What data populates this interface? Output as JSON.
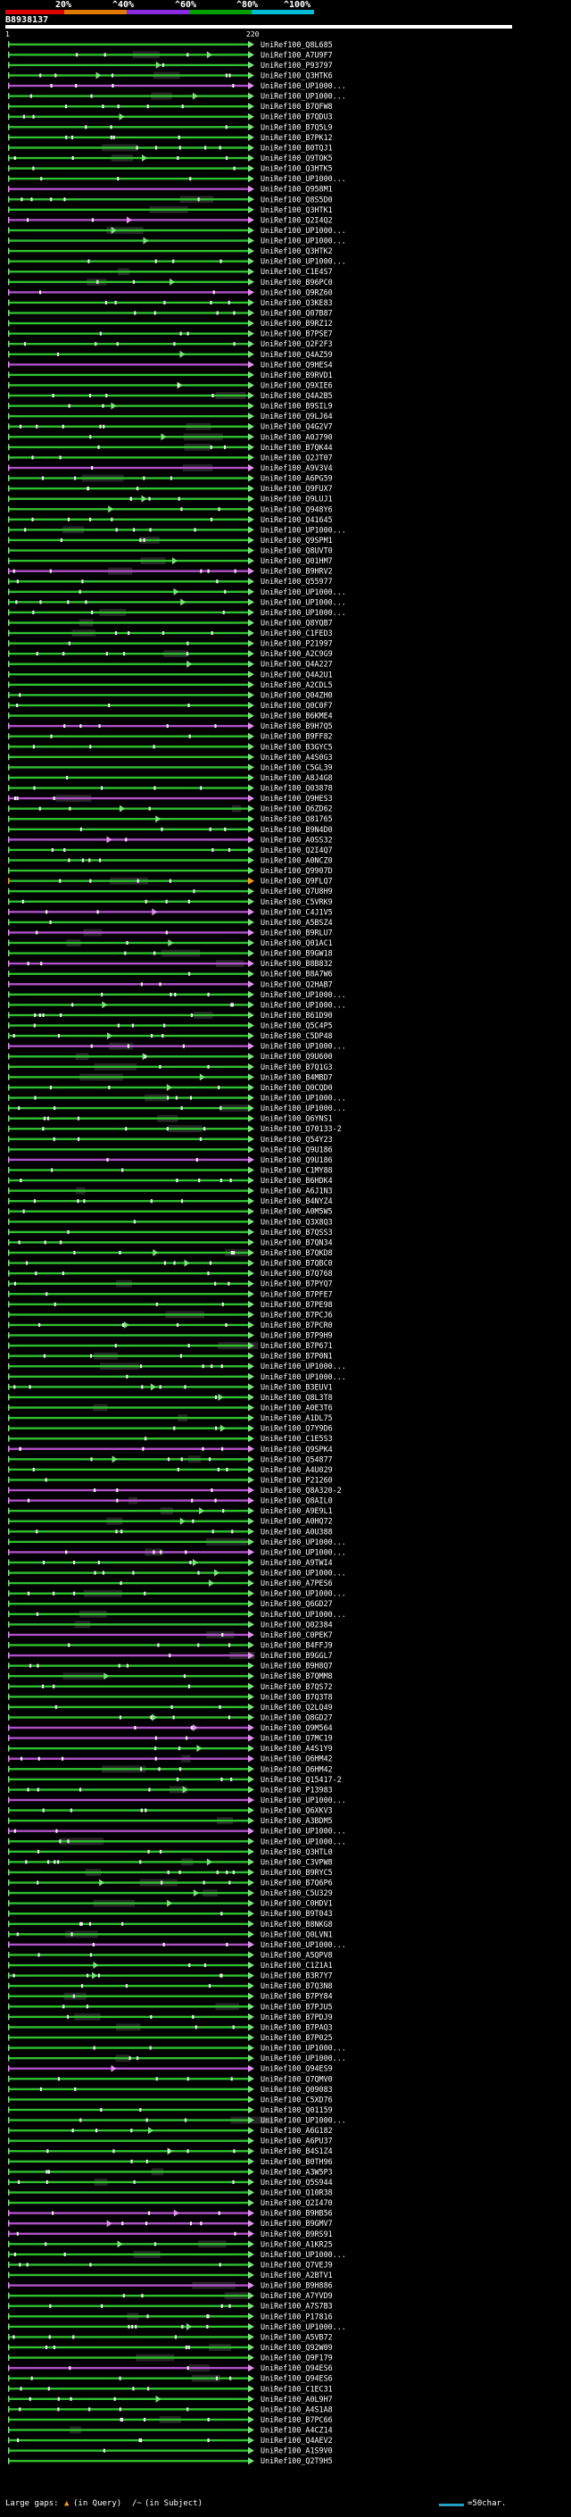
{
  "header": {
    "scale_labels": [
      "20%",
      "^40%",
      "^60%",
      "^80%",
      "^100%"
    ],
    "scale_colors": [
      "#e00000",
      "#e07a00",
      "#8a2be2",
      "#00a000",
      "#00bcd4"
    ],
    "query_id": "B8938137",
    "query_start": "1",
    "query_end": "220"
  },
  "colors": {
    "hit_green": "#2fc02f",
    "hit_magenta": "#b050c8",
    "arrow_green": "#7be37b",
    "arrow_magenta": "#e090ee",
    "arrow_orange": "#ff9a1a",
    "dot": "#ffffff",
    "gap_block": "#242424"
  },
  "hits": [
    {
      "label": "UniRef100_Q8L685",
      "color": "green"
    },
    {
      "label": "UniRef100_A7U9F7",
      "color": "green"
    },
    {
      "label": "UniRef100_P93797",
      "color": "green"
    },
    {
      "label": "UniRef100_Q3HTK6",
      "color": "green"
    },
    {
      "label": "UniRef100_UP1000...",
      "color": "magenta"
    },
    {
      "label": "UniRef100_UP1000...",
      "color": "green"
    },
    {
      "label": "UniRef100_B7QFW8",
      "color": "green"
    },
    {
      "label": "UniRef100_B7QDU3",
      "color": "green"
    },
    {
      "label": "UniRef100_B7Q5L9",
      "color": "green"
    },
    {
      "label": "UniRef100_B7PK12",
      "color": "green"
    },
    {
      "label": "UniRef100_B0TQJ1",
      "color": "green"
    },
    {
      "label": "UniRef100_Q9TOK5",
      "color": "green"
    },
    {
      "label": "UniRef100_Q3HTK5",
      "color": "green"
    },
    {
      "label": "UniRef100_UP1000...",
      "color": "green"
    },
    {
      "label": "UniRef100_Q958M1",
      "color": "magenta"
    },
    {
      "label": "UniRef100_Q8S5D0",
      "color": "green"
    },
    {
      "label": "UniRef100_Q3HTK1",
      "color": "green"
    },
    {
      "label": "UniRef100_Q2I4Q2",
      "color": "magenta"
    },
    {
      "label": "UniRef100_UP1000...",
      "color": "green"
    },
    {
      "label": "UniRef100_UP1000...",
      "color": "green"
    },
    {
      "label": "UniRef100_Q3HTK2",
      "color": "green"
    },
    {
      "label": "UniRef100_UP1000...",
      "color": "green"
    },
    {
      "label": "UniRef100_C1E4S7",
      "color": "green"
    },
    {
      "label": "UniRef100_B96PC0",
      "color": "green"
    },
    {
      "label": "UniRef100_Q9RZ60",
      "color": "magenta"
    },
    {
      "label": "UniRef100_Q3KE83",
      "color": "green"
    },
    {
      "label": "UniRef100_Q07B87",
      "color": "green"
    },
    {
      "label": "UniRef100_B9RZ12",
      "color": "green"
    },
    {
      "label": "UniRef100_B7PSE7",
      "color": "green"
    },
    {
      "label": "UniRef100_Q2F2F3",
      "color": "green"
    },
    {
      "label": "UniRef100_Q4AZ59",
      "color": "green"
    },
    {
      "label": "UniRef100_Q9HES4",
      "color": "magenta"
    },
    {
      "label": "UniRef100_B9RVD1",
      "color": "green"
    },
    {
      "label": "UniRef100_Q9XIE6",
      "color": "green"
    },
    {
      "label": "UniRef100_Q4A2B5",
      "color": "green"
    },
    {
      "label": "UniRef100_B9SIL9",
      "color": "green"
    },
    {
      "label": "UniRef100_Q9LJ64",
      "color": "green"
    },
    {
      "label": "UniRef100_Q4G2V7",
      "color": "green"
    },
    {
      "label": "UniRef100_A0J790",
      "color": "green"
    },
    {
      "label": "UniRef100_B7QK44",
      "color": "green"
    },
    {
      "label": "UniRef100_Q2JT07",
      "color": "green"
    },
    {
      "label": "UniRef100_A9V3V4",
      "color": "magenta"
    },
    {
      "label": "UniRef100_A6PG59",
      "color": "green"
    },
    {
      "label": "UniRef100_Q9FUX7",
      "color": "green"
    },
    {
      "label": "UniRef100_Q9LUJ1",
      "color": "green"
    },
    {
      "label": "UniRef100_Q948Y6",
      "color": "green"
    },
    {
      "label": "UniRef100_Q41645",
      "color": "green"
    },
    {
      "label": "UniRef100_UP1000...",
      "color": "green"
    },
    {
      "label": "UniRef100_Q9SPM1",
      "color": "green"
    },
    {
      "label": "UniRef100_Q8UVT0",
      "color": "green"
    },
    {
      "label": "UniRef100_Q01HM7",
      "color": "green"
    },
    {
      "label": "UniRef100_B9HRV2",
      "color": "magenta"
    },
    {
      "label": "UniRef100_Q55977",
      "color": "green"
    },
    {
      "label": "UniRef100_UP1000...",
      "color": "green"
    },
    {
      "label": "UniRef100_UP1000...",
      "color": "green"
    },
    {
      "label": "UniRef100_UP1000...",
      "color": "green"
    },
    {
      "label": "UniRef100_Q8YQB7",
      "color": "green"
    },
    {
      "label": "UniRef100_C1FED3",
      "color": "green"
    },
    {
      "label": "UniRef100_P21997",
      "color": "green"
    },
    {
      "label": "UniRef100_A2C9G9",
      "color": "green"
    },
    {
      "label": "UniRef100_Q4A227",
      "color": "green"
    },
    {
      "label": "UniRef100_Q4A2U1",
      "color": "green"
    },
    {
      "label": "UniRef100_A2CDL5",
      "color": "green"
    },
    {
      "label": "UniRef100_Q04ZH0",
      "color": "green"
    },
    {
      "label": "UniRef100_Q0C0F7",
      "color": "green"
    },
    {
      "label": "UniRef100_B6KME4",
      "color": "green"
    },
    {
      "label": "UniRef100_B9H7Q5",
      "color": "magenta"
    },
    {
      "label": "UniRef100_B9FF82",
      "color": "green"
    },
    {
      "label": "UniRef100_B3GYC5",
      "color": "green"
    },
    {
      "label": "UniRef100_A4S0G3",
      "color": "green"
    },
    {
      "label": "UniRef100_C5GL39",
      "color": "green"
    },
    {
      "label": "UniRef100_A8J4G8",
      "color": "green"
    },
    {
      "label": "UniRef100_Q03878",
      "color": "green"
    },
    {
      "label": "UniRef100_Q9HES3",
      "color": "magenta"
    },
    {
      "label": "UniRef100_Q6ZD62",
      "color": "green"
    },
    {
      "label": "UniRef100_Q81765",
      "color": "green"
    },
    {
      "label": "UniRef100_B9N4D0",
      "color": "green"
    },
    {
      "label": "UniRef100_A0SS32",
      "color": "magenta"
    },
    {
      "label": "UniRef100_Q2I4Q7",
      "color": "green"
    },
    {
      "label": "UniRef100_A0NCZ0",
      "color": "green"
    },
    {
      "label": "UniRef100_Q9907D",
      "color": "green"
    },
    {
      "label": "UniRef100_Q9FLQ7",
      "color": "orange"
    },
    {
      "label": "UniRef100_Q7U8H9",
      "color": "green"
    },
    {
      "label": "UniRef100_C5VRK9",
      "color": "green"
    },
    {
      "label": "UniRef100_C4J1V5",
      "color": "magenta"
    },
    {
      "label": "UniRef100_A5BSZ4",
      "color": "green"
    },
    {
      "label": "UniRef100_B9RLU7",
      "color": "magenta"
    },
    {
      "label": "UniRef100_Q01AC1",
      "color": "green"
    },
    {
      "label": "UniRef100_B9GW18",
      "color": "green"
    },
    {
      "label": "UniRef100_B8B832",
      "color": "magenta"
    },
    {
      "label": "UniRef100_B8A7W6",
      "color": "green"
    },
    {
      "label": "UniRef100_Q2HAB7",
      "color": "magenta"
    },
    {
      "label": "UniRef100_UP1000...",
      "color": "green"
    },
    {
      "label": "UniRef100_UP1000...",
      "color": "green"
    },
    {
      "label": "UniRef100_B61D90",
      "color": "green"
    },
    {
      "label": "UniRef100_Q5C4P5",
      "color": "green"
    },
    {
      "label": "UniRef100_C5DP48",
      "color": "green"
    },
    {
      "label": "UniRef100_UP1000...",
      "color": "magenta"
    },
    {
      "label": "UniRef100_Q9U600",
      "color": "green"
    },
    {
      "label": "UniRef100_B7Q1G3",
      "color": "green"
    },
    {
      "label": "UniRef100_B4MBD7",
      "color": "green"
    },
    {
      "label": "UniRef100_Q0CQD0",
      "color": "green"
    },
    {
      "label": "UniRef100_UP1000...",
      "color": "green"
    },
    {
      "label": "UniRef100_UP1000...",
      "color": "green"
    },
    {
      "label": "UniRef100_Q6YNS1",
      "color": "green"
    },
    {
      "label": "UniRef100_Q70133-2",
      "color": "green"
    },
    {
      "label": "UniRef100_Q54Y23",
      "color": "green"
    },
    {
      "label": "UniRef100_Q9U186",
      "color": "green"
    },
    {
      "label": "UniRef100_Q9U186",
      "color": "magenta"
    },
    {
      "label": "UniRef100_C1MY88",
      "color": "green"
    },
    {
      "label": "UniRef100_B6HDK4",
      "color": "green"
    },
    {
      "label": "UniRef100_A6J1N3",
      "color": "green"
    },
    {
      "label": "UniRef100_B4NYZ4",
      "color": "green"
    },
    {
      "label": "UniRef100_A0M5W5",
      "color": "green"
    },
    {
      "label": "UniRef100_Q3X8Q3",
      "color": "green"
    },
    {
      "label": "UniRef100_B7QSS3",
      "color": "green"
    },
    {
      "label": "UniRef100_B7QN34",
      "color": "green"
    },
    {
      "label": "UniRef100_B7QKD8",
      "color": "green"
    },
    {
      "label": "UniRef100_B7QBC0",
      "color": "green"
    },
    {
      "label": "UniRef100_B7Q768",
      "color": "green"
    },
    {
      "label": "UniRef100_B7PYQ7",
      "color": "green"
    },
    {
      "label": "UniRef100_B7PFE7",
      "color": "green"
    },
    {
      "label": "UniRef100_B7PE98",
      "color": "green"
    },
    {
      "label": "UniRef100_B7PCJ6",
      "color": "green"
    },
    {
      "label": "UniRef100_B7PCR0",
      "color": "green"
    },
    {
      "label": "UniRef100_B7P9H9",
      "color": "green"
    },
    {
      "label": "UniRef100_B7P671",
      "color": "green"
    },
    {
      "label": "UniRef100_B7P0N1",
      "color": "green"
    },
    {
      "label": "UniRef100_UP1000...",
      "color": "green"
    },
    {
      "label": "UniRef100_UP1000...",
      "color": "green"
    },
    {
      "label": "UniRef100_B3EUV1",
      "color": "green"
    },
    {
      "label": "UniRef100_Q8L3T8",
      "color": "green"
    },
    {
      "label": "UniRef100_A0E3T6",
      "color": "green"
    },
    {
      "label": "UniRef100_A1DL75",
      "color": "green"
    },
    {
      "label": "UniRef100_Q7Y9D6",
      "color": "green"
    },
    {
      "label": "UniRef100_C1E5S3",
      "color": "green"
    },
    {
      "label": "UniRef100_Q9SPK4",
      "color": "magenta"
    },
    {
      "label": "UniRef100_Q54877",
      "color": "green"
    },
    {
      "label": "UniRef100_A4U029",
      "color": "green"
    },
    {
      "label": "UniRef100_P21260",
      "color": "green"
    },
    {
      "label": "UniRef100_Q8A320-2",
      "color": "magenta"
    },
    {
      "label": "UniRef100_Q8AIL0",
      "color": "magenta"
    },
    {
      "label": "UniRef100_A9E9L1",
      "color": "green"
    },
    {
      "label": "UniRef100_A0HQ72",
      "color": "green"
    },
    {
      "label": "UniRef100_A0U388",
      "color": "green"
    },
    {
      "label": "UniRef100_UP1000...",
      "color": "green"
    },
    {
      "label": "UniRef100_UP1000...",
      "color": "magenta"
    },
    {
      "label": "UniRef100_A9TWI4",
      "color": "green"
    },
    {
      "label": "UniRef100_UP1000...",
      "color": "green"
    },
    {
      "label": "UniRef100_A7PES6",
      "color": "green"
    },
    {
      "label": "UniRef100_UP1000...",
      "color": "green"
    },
    {
      "label": "UniRef100_Q6GD27",
      "color": "green"
    },
    {
      "label": "UniRef100_UP1000...",
      "color": "green"
    },
    {
      "label": "UniRef100_Q02384",
      "color": "green"
    },
    {
      "label": "UniRef100_C0PEK7",
      "color": "magenta"
    },
    {
      "label": "UniRef100_B4FFJ9",
      "color": "green"
    },
    {
      "label": "UniRef100_B9GGL7",
      "color": "magenta"
    },
    {
      "label": "UniRef100_B9H8Q7",
      "color": "green"
    },
    {
      "label": "UniRef100_B7QMM8",
      "color": "green"
    },
    {
      "label": "UniRef100_B7QS72",
      "color": "green"
    },
    {
      "label": "UniRef100_B7Q3T8",
      "color": "green"
    },
    {
      "label": "UniRef100_Q2LQ49",
      "color": "green"
    },
    {
      "label": "UniRef100_Q8GD27",
      "color": "green"
    },
    {
      "label": "UniRef100_Q9M564",
      "color": "magenta"
    },
    {
      "label": "UniRef100_Q7MC19",
      "color": "magenta"
    },
    {
      "label": "UniRef100_A4S1Y9",
      "color": "green"
    },
    {
      "label": "UniRef100_Q6HM42",
      "color": "magenta"
    },
    {
      "label": "UniRef100_Q6HM42",
      "color": "green"
    },
    {
      "label": "UniRef100_Q15417-2",
      "color": "green"
    },
    {
      "label": "UniRef100_P13983",
      "color": "green"
    },
    {
      "label": "UniRef100_UP1000...",
      "color": "magenta"
    },
    {
      "label": "UniRef100_Q6XKV3",
      "color": "green"
    },
    {
      "label": "UniRef100_A3BDM5",
      "color": "green"
    },
    {
      "label": "UniRef100_UP1000...",
      "color": "magenta"
    },
    {
      "label": "UniRef100_UP1000...",
      "color": "green"
    },
    {
      "label": "UniRef100_Q3HTL0",
      "color": "green"
    },
    {
      "label": "UniRef100_C3VPW8",
      "color": "green"
    },
    {
      "label": "UniRef100_B9RYC5",
      "color": "green"
    },
    {
      "label": "UniRef100_B7Q6P6",
      "color": "green"
    },
    {
      "label": "UniRef100_C5U329",
      "color": "green"
    },
    {
      "label": "UniRef100_C0HDV1",
      "color": "green"
    },
    {
      "label": "UniRef100_B9T043",
      "color": "green"
    },
    {
      "label": "UniRef100_B8NKG8",
      "color": "green"
    },
    {
      "label": "UniRef100_Q0LVN1",
      "color": "green"
    },
    {
      "label": "UniRef100_UP1000...",
      "color": "magenta"
    },
    {
      "label": "UniRef100_A5QPV8",
      "color": "green"
    },
    {
      "label": "UniRef100_C1Z1A1",
      "color": "green"
    },
    {
      "label": "UniRef100_B3R7Y7",
      "color": "green"
    },
    {
      "label": "UniRef100_B7Q3N8",
      "color": "green"
    },
    {
      "label": "UniRef100_B7PY84",
      "color": "green"
    },
    {
      "label": "UniRef100_B7PJU5",
      "color": "green"
    },
    {
      "label": "UniRef100_B7PDJ9",
      "color": "green"
    },
    {
      "label": "UniRef100_B7PAQ3",
      "color": "green"
    },
    {
      "label": "UniRef100_B7P025",
      "color": "green"
    },
    {
      "label": "UniRef100_UP1000...",
      "color": "green"
    },
    {
      "label": "UniRef100_UP1000...",
      "color": "green"
    },
    {
      "label": "UniRef100_Q94ES9",
      "color": "magenta"
    },
    {
      "label": "UniRef100_Q7QMV0",
      "color": "green"
    },
    {
      "label": "UniRef100_Q09083",
      "color": "green"
    },
    {
      "label": "UniRef100_C5XD76",
      "color": "green"
    },
    {
      "label": "UniRef100_Q01159",
      "color": "green"
    },
    {
      "label": "UniRef100_UP1000...",
      "color": "green"
    },
    {
      "label": "UniRef100_A6G182",
      "color": "green"
    },
    {
      "label": "UniRef100_A6PU37",
      "color": "green"
    },
    {
      "label": "UniRef100_B4S1Z4",
      "color": "green"
    },
    {
      "label": "UniRef100_B0TH96",
      "color": "green"
    },
    {
      "label": "UniRef100_A3W5P3",
      "color": "green"
    },
    {
      "label": "UniRef100_Q5S944",
      "color": "green"
    },
    {
      "label": "UniRef100_Q10R38",
      "color": "green"
    },
    {
      "label": "UniRef100_Q2I470",
      "color": "green"
    },
    {
      "label": "UniRef100_B9HB56",
      "color": "magenta"
    },
    {
      "label": "UniRef100_B9GMV7",
      "color": "magenta"
    },
    {
      "label": "UniRef100_B9RS91",
      "color": "magenta"
    },
    {
      "label": "UniRef100_A1KR25",
      "color": "green"
    },
    {
      "label": "UniRef100_UP1000...",
      "color": "green"
    },
    {
      "label": "UniRef100_Q7VEJ9",
      "color": "green"
    },
    {
      "label": "UniRef100_A2BTV1",
      "color": "green"
    },
    {
      "label": "UniRef100_B9H886",
      "color": "magenta"
    },
    {
      "label": "UniRef100_A7YVD9",
      "color": "green"
    },
    {
      "label": "UniRef100_A7S7B3",
      "color": "green"
    },
    {
      "label": "UniRef100_P17816",
      "color": "green"
    },
    {
      "label": "UniRef100_UP1000...",
      "color": "green"
    },
    {
      "label": "UniRef100_A5VB72",
      "color": "green"
    },
    {
      "label": "UniRef100_Q92W09",
      "color": "green"
    },
    {
      "label": "UniRef100_Q9F179",
      "color": "green"
    },
    {
      "label": "UniRef100_Q94ES6",
      "color": "magenta"
    },
    {
      "label": "UniRef100_Q94ES6",
      "color": "green"
    },
    {
      "label": "UniRef100_C1EC31",
      "color": "green"
    },
    {
      "label": "UniRef100_A0L9H7",
      "color": "green"
    },
    {
      "label": "UniRef100_A4S1A8",
      "color": "green"
    },
    {
      "label": "UniRef100_B7PC66",
      "color": "green"
    },
    {
      "label": "UniRef100_A4CZ14",
      "color": "green"
    },
    {
      "label": "UniRef100_Q4AEV2",
      "color": "green"
    },
    {
      "label": "UniRef100_A1S9V0",
      "color": "green"
    },
    {
      "label": "UniRef100_Q2T9H5",
      "color": "green"
    }
  ],
  "footer": {
    "legend_label": "Large gaps:",
    "legend_query": "(in Query)",
    "legend_subject": "(in Subject)",
    "scale_label": "=50char."
  }
}
